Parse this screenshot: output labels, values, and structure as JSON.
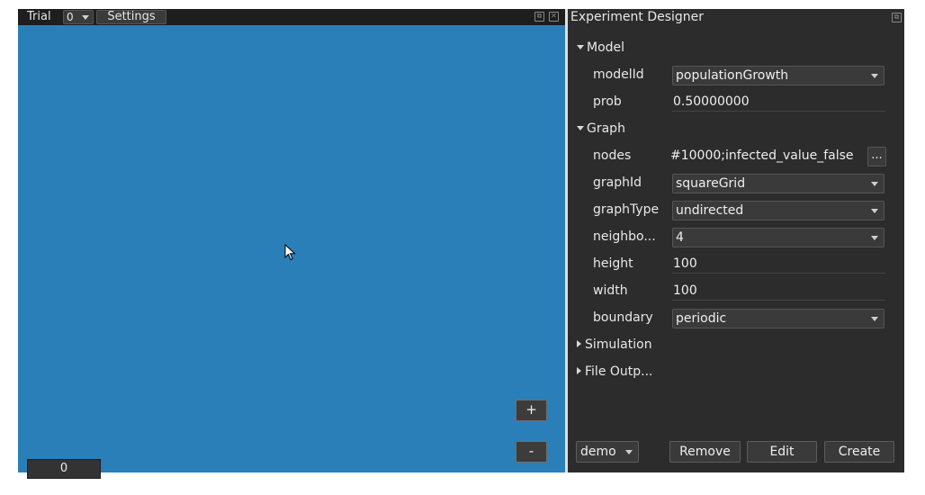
{
  "left": {
    "trial_label": "Trial",
    "trial_value": "0",
    "settings_label": "Settings",
    "zoom_in_label": "+",
    "zoom_out_label": "-",
    "step_value": "0",
    "canvas_color": "#2a7fb8"
  },
  "right": {
    "title": "Experiment Designer",
    "sections": {
      "model": "Model",
      "graph": "Graph",
      "simulation": "Simulation",
      "file_output": "File Outp..."
    },
    "model": {
      "modelId_label": "modelId",
      "modelId_value": "populationGrowth",
      "prob_label": "prob",
      "prob_value": "0.50000000"
    },
    "graph": {
      "nodes_label": "nodes",
      "nodes_value": "#10000;infected_value_false",
      "nodes_button": "...",
      "graphId_label": "graphId",
      "graphId_value": "squareGrid",
      "graphType_label": "graphType",
      "graphType_value": "undirected",
      "neighbours_label": "neighbo...",
      "neighbours_value": "4",
      "height_label": "height",
      "height_value": "100",
      "width_label": "width",
      "width_value": "100",
      "boundary_label": "boundary",
      "boundary_value": "periodic"
    },
    "footer": {
      "experiment_value": "demo",
      "remove_label": "Remove",
      "edit_label": "Edit",
      "create_label": "Create"
    }
  },
  "icons": [
    "restore-icon",
    "close-icon",
    "expand-icon",
    "collapse-icon",
    "mouse-cursor-icon"
  ]
}
